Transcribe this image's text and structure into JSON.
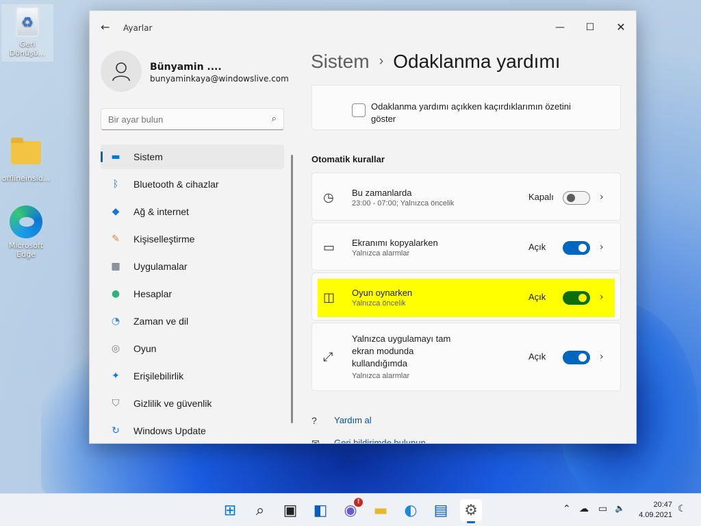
{
  "desktop": {
    "icons": [
      {
        "label": "Geri Dönüşü...",
        "icon": "recycle-bin-icon"
      },
      {
        "label": "offlineinsid...",
        "icon": "folder-icon"
      },
      {
        "label": "Microsoft Edge",
        "icon": "edge-icon"
      }
    ]
  },
  "window": {
    "title": "Ayarlar",
    "back_icon": "back-arrow-icon",
    "controls": {
      "minimize": "—",
      "maximize": "☐",
      "close": "✕"
    }
  },
  "profile": {
    "name": "Bünyamin ....",
    "email": "bunyaminkaya@windowslive.com"
  },
  "search": {
    "placeholder": "Bir ayar bulun",
    "icon": "⌕"
  },
  "nav": {
    "items": [
      {
        "label": "Sistem",
        "icon": "▬",
        "color": "#0078d4",
        "selected": true
      },
      {
        "label": "Bluetooth & cihazlar",
        "icon": "ᛒ",
        "color": "#0078d4"
      },
      {
        "label": "Ağ & internet",
        "icon": "◆",
        "color": "#1a73d9"
      },
      {
        "label": "Kişiselleştirme",
        "icon": "✎",
        "color": "#d08b3c"
      },
      {
        "label": "Uygulamalar",
        "icon": "▦",
        "color": "#4a5a6a"
      },
      {
        "label": "Hesaplar",
        "icon": "●",
        "color": "#2fb37a"
      },
      {
        "label": "Zaman ve dil",
        "icon": "◔",
        "color": "#3a88d8"
      },
      {
        "label": "Oyun",
        "icon": "◎",
        "color": "#7a7a7a"
      },
      {
        "label": "Erişilebilirlik",
        "icon": "✦",
        "color": "#1a73d9"
      },
      {
        "label": "Gizlilik ve güvenlik",
        "icon": "⛉",
        "color": "#6a6a6a"
      },
      {
        "label": "Windows Update",
        "icon": "↻",
        "color": "#1a73d9"
      }
    ]
  },
  "header": {
    "crumb": "Sistem",
    "separator": "›",
    "current": "Odaklanma yardımı"
  },
  "summary_option": {
    "label": "Odaklanma yardımı açıkken kaçırdıklarımın özetini göster",
    "checked": false
  },
  "auto_rules": {
    "title": "Otomatik kurallar",
    "rules": [
      {
        "title": "Bu zamanlarda",
        "subtitle": "23:00 - 07:00; Yalnızca öncelik",
        "state": "Kapalı",
        "on": false,
        "icon": "◷"
      },
      {
        "title": "Ekranımı kopyalarken",
        "subtitle": "Yalnızca alarmlar",
        "state": "Açık",
        "on": true,
        "icon": "▭"
      },
      {
        "title": "Oyun oynarken",
        "subtitle": "Yalnızca öncelik",
        "state": "Açık",
        "on": true,
        "highlighted": true,
        "icon": "◫"
      },
      {
        "title": "Yalnızca uygulamayı tam ekran modunda kullandığımda",
        "subtitle": "Yalnızca alarmlar",
        "state": "Açık",
        "on": true,
        "icon": "⤢"
      }
    ],
    "chevron": "›"
  },
  "links": [
    {
      "label": "Yardım al",
      "icon": "?"
    },
    {
      "label": "Geri bildirimde bulunun",
      "icon": "✉"
    }
  ],
  "taskbar": {
    "apps": [
      {
        "name": "start",
        "icon": "⊞",
        "color": "#0078d4"
      },
      {
        "name": "search",
        "icon": "⌕",
        "color": "#222"
      },
      {
        "name": "task-view",
        "icon": "▣",
        "color": "#222"
      },
      {
        "name": "widgets",
        "icon": "◧",
        "color": "#0a5cbf"
      },
      {
        "name": "chat",
        "icon": "◉",
        "color": "#6a5acd",
        "badge": "!"
      },
      {
        "name": "file-explorer",
        "icon": "▬",
        "color": "#e9b72d"
      },
      {
        "name": "edge",
        "icon": "◐",
        "color": "#1a8ad8"
      },
      {
        "name": "store",
        "icon": "▤",
        "color": "#0a5cbf"
      },
      {
        "name": "settings",
        "icon": "⚙",
        "color": "#555",
        "active": true
      }
    ],
    "tray": {
      "chevron": "⌃",
      "cloud": "☁",
      "network": "▭",
      "volume": "🔈",
      "night": "☾"
    },
    "time": "20:47",
    "date": "4.09.2021"
  }
}
